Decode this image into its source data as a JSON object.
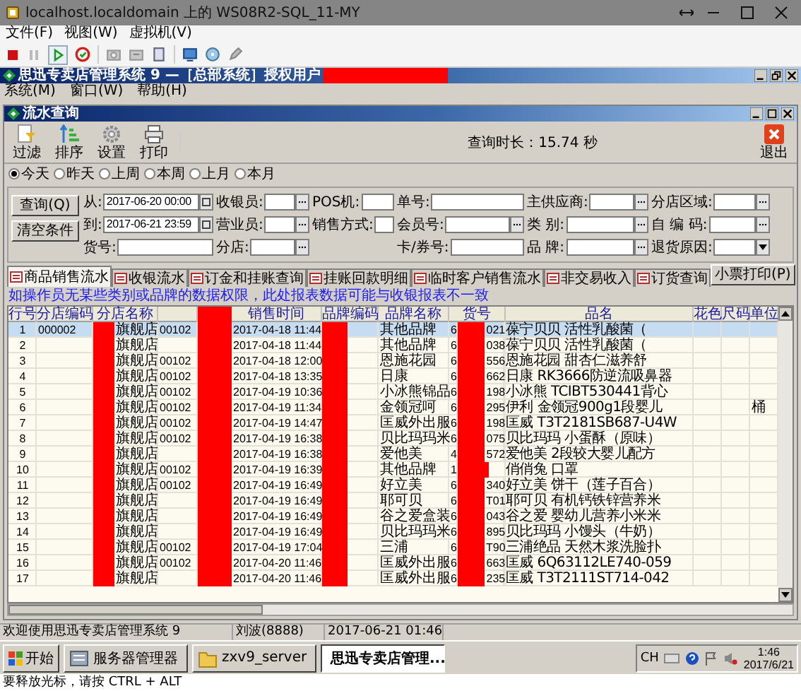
{
  "host": {
    "title": "localhost.localdomain 上的 WS08R2-SQL_11-MY",
    "menu": [
      "文件(F)",
      "视图(W)",
      "虚拟机(V)"
    ],
    "status": "要释放光标，请按 CTRL + ALT"
  },
  "app": {
    "title": "思迅专卖店管理系统 9 —［总部系统］授权用户",
    "menu": [
      "系统(M)",
      "窗口(W)",
      "帮助(H)"
    ]
  },
  "child": {
    "title": "流水查询",
    "toolbar": [
      "过滤",
      "排序",
      "设置",
      "打印"
    ],
    "query_time": "查询时长：15.74 秒",
    "exit": "退出"
  },
  "periods": [
    {
      "label": "今天",
      "selected": true
    },
    {
      "label": "昨天",
      "selected": false
    },
    {
      "label": "上周",
      "selected": false
    },
    {
      "label": "本周",
      "selected": false
    },
    {
      "label": "上月",
      "selected": false
    },
    {
      "label": "本月",
      "selected": false
    }
  ],
  "filters": {
    "buttons": [
      "查询(Q)",
      "清空条件"
    ],
    "rows": [
      [
        {
          "label": "从:",
          "value": "2017-06-20 00:00",
          "kind": "date"
        },
        {
          "label": "收银员:",
          "kind": "lookup"
        },
        {
          "label": "POS机:",
          "kind": "text"
        },
        {
          "label": "单号:",
          "kind": "text"
        },
        {
          "label": "主供应商:",
          "kind": "lookup"
        },
        {
          "label": "分店区域:",
          "kind": "lookup"
        }
      ],
      [
        {
          "label": "到:",
          "value": "2017-06-21 23:59",
          "kind": "date"
        },
        {
          "label": "营业员:",
          "kind": "lookup"
        },
        {
          "label": "销售方式:",
          "kind": "text"
        },
        {
          "label": "会员号:",
          "kind": "lookup"
        },
        {
          "label": "类 别:",
          "kind": "lookup"
        },
        {
          "label": "自 编 码:",
          "kind": "lookup"
        }
      ],
      [
        {
          "label": "货号:",
          "kind": "text"
        },
        {
          "label": "分店:",
          "kind": "lookup"
        },
        "",
        {
          "label": "卡/券号:",
          "kind": "text"
        },
        {
          "label": "品 牌:",
          "kind": "lookup"
        },
        {
          "label": "退货原因:",
          "kind": "select"
        }
      ]
    ]
  },
  "tabs": [
    {
      "label": "商品销售流水",
      "selected": true
    },
    {
      "label": "收银流水",
      "selected": false
    },
    {
      "label": "订金和挂账查询",
      "selected": false
    },
    {
      "label": "挂账回款明细",
      "selected": false
    },
    {
      "label": "临时客户销售流水",
      "selected": false
    },
    {
      "label": "非交易收入",
      "selected": false
    },
    {
      "label": "订货查询",
      "selected": false
    }
  ],
  "print_button": "小票打印(P)",
  "notice": "如操作员无某些类别或品牌的数据权限，此处报表数据可能与收银报表不一致",
  "table": {
    "columns": [
      {
        "label": "行号"
      },
      {
        "label": "分店编码"
      },
      {
        "label": "分店名称"
      },
      {
        "kind": "blank"
      },
      {
        "kind": "redacted"
      },
      {
        "label": "销售时间"
      },
      {
        "label": "品牌编码"
      },
      {
        "label": "品牌名称"
      },
      {
        "label": "货号"
      },
      {
        "label": "品名"
      },
      {
        "label": "花色"
      },
      {
        "label": "尺码"
      },
      {
        "label": "单位"
      }
    ],
    "rows": [
      {
        "no": "1",
        "selected": true,
        "store_code": "000002",
        "store_name": "旗舰店",
        "code": "00102",
        "time": "2017-04-18 11:44",
        "brand": "其他品牌",
        "item_start": "6",
        "item_end": "021",
        "name": "葆宁贝贝 活性乳酸菌（"
      },
      {
        "no": "2",
        "selected": false,
        "store_name": "旗舰店",
        "time": "2017-04-18 11:44",
        "brand": "其他品牌",
        "item_start": "6",
        "item_end": "038",
        "name": "葆宁贝贝 活性乳酸菌（"
      },
      {
        "no": "3",
        "selected": false,
        "store_name": "旗舰店",
        "code": "00102",
        "time": "2017-04-18 12:00",
        "brand": "恩施花园",
        "item_start": "6",
        "item_end": "556",
        "name": "恩施花园 甜杏仁滋养舒"
      },
      {
        "no": "4",
        "selected": false,
        "store_name": "旗舰店",
        "code": "00102",
        "time": "2017-04-18 13:35",
        "brand": "日康",
        "item_start": "6",
        "item_end": "662",
        "name": "日康 RK3666防逆流吸鼻器"
      },
      {
        "no": "5",
        "selected": false,
        "store_name": "旗舰店",
        "code": "00102",
        "time": "2017-04-19 10:36",
        "brand": "小冰熊锦品",
        "item_start": "6",
        "item_end": "198",
        "name": "小冰熊 TCIBT530441背心"
      },
      {
        "no": "6",
        "selected": false,
        "store_name": "旗舰店",
        "code": "00102",
        "time": "2017-04-19 11:34",
        "brand": "金领冠呵",
        "item_start": "6",
        "item_end": "295",
        "name": "伊利 金领冠900g1段婴儿",
        "unit": "桶"
      },
      {
        "no": "7",
        "selected": false,
        "store_name": "旗舰店",
        "code": "00102",
        "time": "2017-04-19 14:47",
        "brand": "匡威外出服",
        "item_start": "6",
        "item_end": "198",
        "name": "匡威 T3T2181SB687-U4W"
      },
      {
        "no": "8",
        "selected": false,
        "store_name": "旗舰店",
        "code": "00102",
        "time": "2017-04-19 16:38",
        "brand": "贝比玛玛米",
        "item_start": "6",
        "item_end": "075",
        "name": "贝比玛玛 小蛋酥（原味）"
      },
      {
        "no": "9",
        "selected": false,
        "store_name": "旗舰店",
        "time": "2017-04-19 16:38",
        "brand": "爱他美",
        "item_start": "4",
        "item_end": "572",
        "name": "爱他美 2段较大婴儿配方"
      },
      {
        "no": "10",
        "selected": false,
        "store_name": "旗舰店",
        "code": "00102",
        "time": "2017-04-19 16:39",
        "brand": "其他品牌",
        "item_start": "1",
        "name": "俏俏兔 口罩"
      },
      {
        "no": "11",
        "selected": false,
        "store_name": "旗舰店",
        "code": "00102",
        "time": "2017-04-19 16:49",
        "brand": "好立美",
        "item_start": "6",
        "item_end": "340",
        "name": "好立美 饼干（莲子百合）"
      },
      {
        "no": "12",
        "selected": false,
        "store_name": "旗舰店",
        "time": "2017-04-19 16:49",
        "brand": "耶可贝",
        "item_start": "6",
        "item_end": "T01",
        "name": "耶可贝 有机钙铁锌营养米"
      },
      {
        "no": "13",
        "selected": false,
        "store_name": "旗舰店",
        "time": "2017-04-19 16:49",
        "brand": "谷之爱盒装",
        "item_start": "6",
        "item_end": "043",
        "name": "谷之爱 婴幼儿营养小米米"
      },
      {
        "no": "14",
        "selected": false,
        "store_name": "旗舰店",
        "time": "2017-04-19 16:49",
        "brand": "贝比玛玛米",
        "item_start": "6",
        "item_end": "895",
        "name": "贝比玛玛 小馒头（牛奶）"
      },
      {
        "no": "15",
        "selected": false,
        "store_name": "旗舰店",
        "code": "00102",
        "time": "2017-04-19 17:04",
        "brand": "三浦",
        "item_start": "6",
        "item_end": "T90",
        "name": "三浦绝品 天然木浆洗脸扑"
      },
      {
        "no": "16",
        "selected": false,
        "store_name": "旗舰店",
        "code": "00102",
        "time": "2017-04-20 11:46",
        "brand": "匡威外出服",
        "item_start": "6",
        "item_end": "663",
        "name": "匡威 6Q63112LE740-059"
      },
      {
        "no": "17",
        "selected": false,
        "store_name": "旗舰店",
        "time": "2017-04-20 11:46",
        "brand": "匡威外出服",
        "item_start": "6",
        "item_end": "235",
        "name": "匡威 T3T2111ST714-042"
      }
    ]
  },
  "status_bar": [
    "欢迎使用思迅专卖店管理系统 9",
    "刘波(8888)",
    "2017-06-21 01:46"
  ],
  "taskbar": {
    "start": "开始",
    "items": [
      {
        "label": "服务器管理器",
        "selected": false
      },
      {
        "label": "zxv9_server",
        "selected": false
      },
      {
        "label": "思迅专卖店管理...",
        "selected": true
      }
    ],
    "language": "CH",
    "time": "1:46",
    "date": "2017/6/21"
  }
}
